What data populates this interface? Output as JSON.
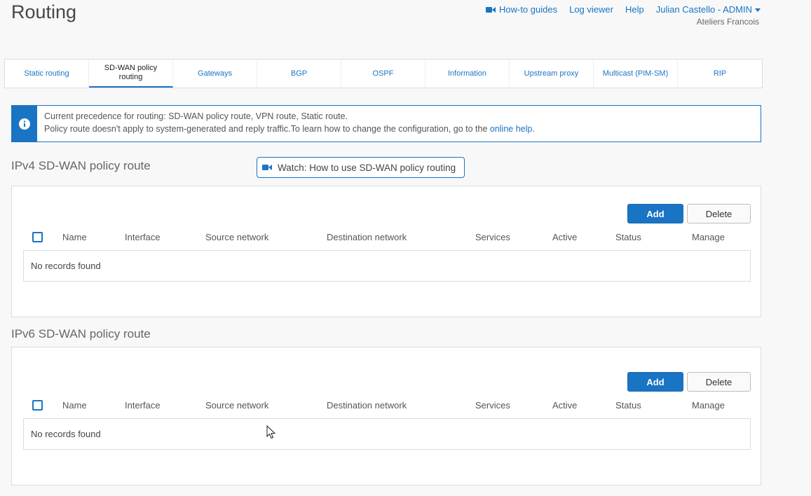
{
  "header": {
    "title": "Routing",
    "nav": {
      "guides": "How-to guides",
      "log_viewer": "Log viewer",
      "help": "Help",
      "user": "Julian Castello - ADMIN"
    },
    "org": "Ateliers Francois"
  },
  "tabs": [
    {
      "label": "Static routing"
    },
    {
      "label": "SD-WAN policy routing",
      "active": true
    },
    {
      "label": "Gateways"
    },
    {
      "label": "BGP"
    },
    {
      "label": "OSPF"
    },
    {
      "label": "Information"
    },
    {
      "label": "Upstream proxy"
    },
    {
      "label": "Multicast (PIM-SM)"
    },
    {
      "label": "RIP"
    }
  ],
  "info": {
    "line1": "Current precedence for routing: SD-WAN policy route, VPN route, Static route.",
    "line2_prefix": "Policy route doesn't apply to system-generated and reply traffic.To learn how to change the configuration, go to the ",
    "link": "online help",
    "line2_suffix": "."
  },
  "watch_button": "Watch: How to use SD-WAN policy routing",
  "sections": [
    {
      "title": "IPv4 SD-WAN policy route",
      "add": "Add",
      "delete": "Delete",
      "columns": [
        "Name",
        "Interface",
        "Source network",
        "Destination network",
        "Services",
        "Active",
        "Status",
        "Manage"
      ],
      "empty": "No records found"
    },
    {
      "title": "IPv6 SD-WAN policy route",
      "add": "Add",
      "delete": "Delete",
      "columns": [
        "Name",
        "Interface",
        "Source network",
        "Destination network",
        "Services",
        "Active",
        "Status",
        "Manage"
      ],
      "empty": "No records found"
    }
  ],
  "colors": {
    "accent": "#1a74c4",
    "background": "#f8f8f8"
  }
}
